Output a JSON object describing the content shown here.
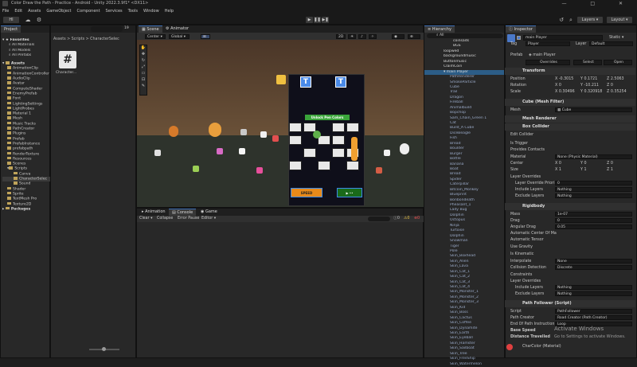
{
  "window": {
    "title": "Color Draw the Path - Practice - Android - Unity 2022.3.9f1* <DX11>",
    "controls": [
      "—",
      "□",
      "✕"
    ]
  },
  "menu": [
    "File",
    "Edit",
    "Assets",
    "GameObject",
    "Component",
    "Services",
    "Tools",
    "Window",
    "Help"
  ],
  "toolbar": {
    "account": "HI",
    "layers": "Layers",
    "layout": "Layout"
  },
  "project": {
    "tab": "Project",
    "breadcrumb": "Assets > Scripts > CharacterSelec",
    "search_count": "19",
    "favorites_label": "Favorites",
    "favorites": [
      "All Materials",
      "All Models",
      "All Prefabs"
    ],
    "assets_label": "Assets",
    "folders": [
      "AnimationClip",
      "AnimationController",
      "AudioClip",
      "Avatar",
      "ComputeShader",
      "EnemyPrefab",
      "Font",
      "LightingSettings",
      "LightProbes",
      "Material 1",
      "Mesh",
      "Music Tracks",
      "PathCreator",
      "Plugins",
      "Prefab",
      "PrefabInstance",
      "prefabpath",
      "RenderTexture",
      "Resources",
      "Scenes",
      "Scripts",
      "Canva",
      "CharacterSelec",
      "Sound",
      "Shader",
      "Sprite",
      "TextMesh Pro",
      "Texture2D"
    ],
    "packages_label": "Packages",
    "file_name": "Character...",
    "file_icon": "#"
  },
  "scene": {
    "tabs": [
      "Scene",
      "Animator"
    ],
    "pivot": "Center",
    "space": "Global",
    "mode_2d": "2D",
    "banner": "Unlock Pen Colors",
    "bottom_btn_left": "SPEED",
    "bottom_btn_right": "▶ ••"
  },
  "console": {
    "tabs": [
      "Animation",
      "Console",
      "Game"
    ],
    "clear": "Clear",
    "collapse": "Collapse",
    "error_pause": "Error Pause",
    "editor": "Editor",
    "counts": [
      "0",
      "0",
      "0"
    ]
  },
  "hierarchy": {
    "tab": "Hierarchy",
    "search": "All",
    "items": [
      "coinsads",
      "BGS",
      "loopwed",
      "backgroundmusic",
      "Buttonmusic",
      "ClaimCoin",
      "main Player",
      "PathRenderer",
      "SmokeParticle",
      "Cube",
      "Trail",
      "Dragon",
      "Fireball",
      "Animalbuild",
      "Bopchop",
      "Sam_Chain_Green 1",
      "Cat",
      "Build_A Cube",
      "DiceBeagle",
      "Fish",
      "Bread",
      "Boulder",
      "Burger",
      "Bottle",
      "Banana",
      "Boat",
      "Bread",
      "Spider",
      "Caterpillar",
      "Bitcoin_Monkey",
      "Blueprint",
      "Bonbondeath",
      "Pheasant_1",
      "Lady Bug",
      "Dolphin",
      "Octopus",
      "Ninja",
      "Turtoise",
      "Dolphin",
      "Snowman",
      "Tiger",
      "Pole",
      "Skin_Boxhead",
      "Skin_Alien",
      "Skin_Lava",
      "Skin_Cat_1",
      "Skin_Cat_2",
      "Skin_Cat_3",
      "Skin_Cat_4",
      "Skin_Monster_1",
      "Skin_Monster_2",
      "Skin_Monster_3",
      "Skin_Kid",
      "Skin_Boss",
      "Skin_Cactus",
      "Skin_Coffee",
      "Skin_Dynamite",
      "Skin_Earth",
      "Skin_Eyeball",
      "Skin_Hamster",
      "Skin_Sailboat",
      "Skin_Tree",
      "Skin_FreeShip",
      "Skin_Watermelon"
    ]
  },
  "inspector": {
    "tab": "Inspector",
    "static": "Static",
    "name": "main Player",
    "tag_label": "Tag",
    "tag": "Player",
    "layer_label": "Layer",
    "layer": "Default",
    "prefab_label": "Prefab",
    "prefab": "main Player",
    "overrides": "Overrides",
    "select": "Select",
    "open": "Open",
    "transform": {
      "title": "Transform",
      "position": [
        "-0.3015",
        "0.1721",
        "2.5063"
      ],
      "rotation": [
        "0",
        "-10.211",
        "0"
      ],
      "scale": [
        "0.30496",
        "0.320918",
        "0.35254"
      ],
      "labels": [
        "Position",
        "Rotation",
        "Scale"
      ]
    },
    "mesh_filter": {
      "title": "Cube (Mesh Filter)",
      "mesh_label": "Mesh",
      "mesh": "Cube"
    },
    "mesh_renderer": "Mesh Renderer",
    "box_collider": {
      "title": "Box Collider",
      "edit": "Edit Collider",
      "is_trigger": "Is Trigger",
      "provides": "Provides Contacts",
      "material_label": "Material",
      "material": "None (Physic Material)",
      "center_label": "Center",
      "center": [
        "0",
        "0",
        "0"
      ],
      "size_label": "Size",
      "size": [
        "1",
        "1",
        "1"
      ],
      "layer_overrides": "Layer Overrides",
      "priority": "Layer Override Priori",
      "priority_val": "0",
      "include": "Include Layers",
      "exclude": "Exclude Layers",
      "nothing": "Nothing"
    },
    "rigidbody": {
      "title": "Rigidbody",
      "mass_label": "Mass",
      "mass": "1e-07",
      "drag_label": "Drag",
      "drag": "0",
      "ang_label": "Angular Drag",
      "ang": "0.05",
      "auto_com": "Automatic Center Of Ma",
      "auto_tensor": "Automatic Tensor",
      "gravity": "Use Gravity",
      "kinematic": "Is Kinematic",
      "interp_label": "Interpolate",
      "interp": "None",
      "collision_label": "Collision Detection",
      "collision": "Discrete",
      "constraints": "Constraints",
      "layer_overrides": "Layer Overrides",
      "include": "Include Layers",
      "exclude": "Exclude Layers",
      "nothing": "Nothing"
    },
    "path_follower": {
      "title": "Path Follower (Script)",
      "script_label": "Script",
      "script": "PathFollower",
      "creator_label": "Path Creator",
      "creator": "Road Creator (Path Creator)",
      "end_label": "End Of Path Instruction",
      "end": "Loop",
      "speed": "Base Speed",
      "distance": "Distance Travelled"
    },
    "material": "CharColor (Material)",
    "watermark1": "Activate Windows",
    "watermark2": "Go to Settings to activate Windows."
  },
  "colors": {
    "accent": "#3d6fb6",
    "selection": "#2c5d87",
    "panel": "#282828",
    "bg": "#191919"
  }
}
